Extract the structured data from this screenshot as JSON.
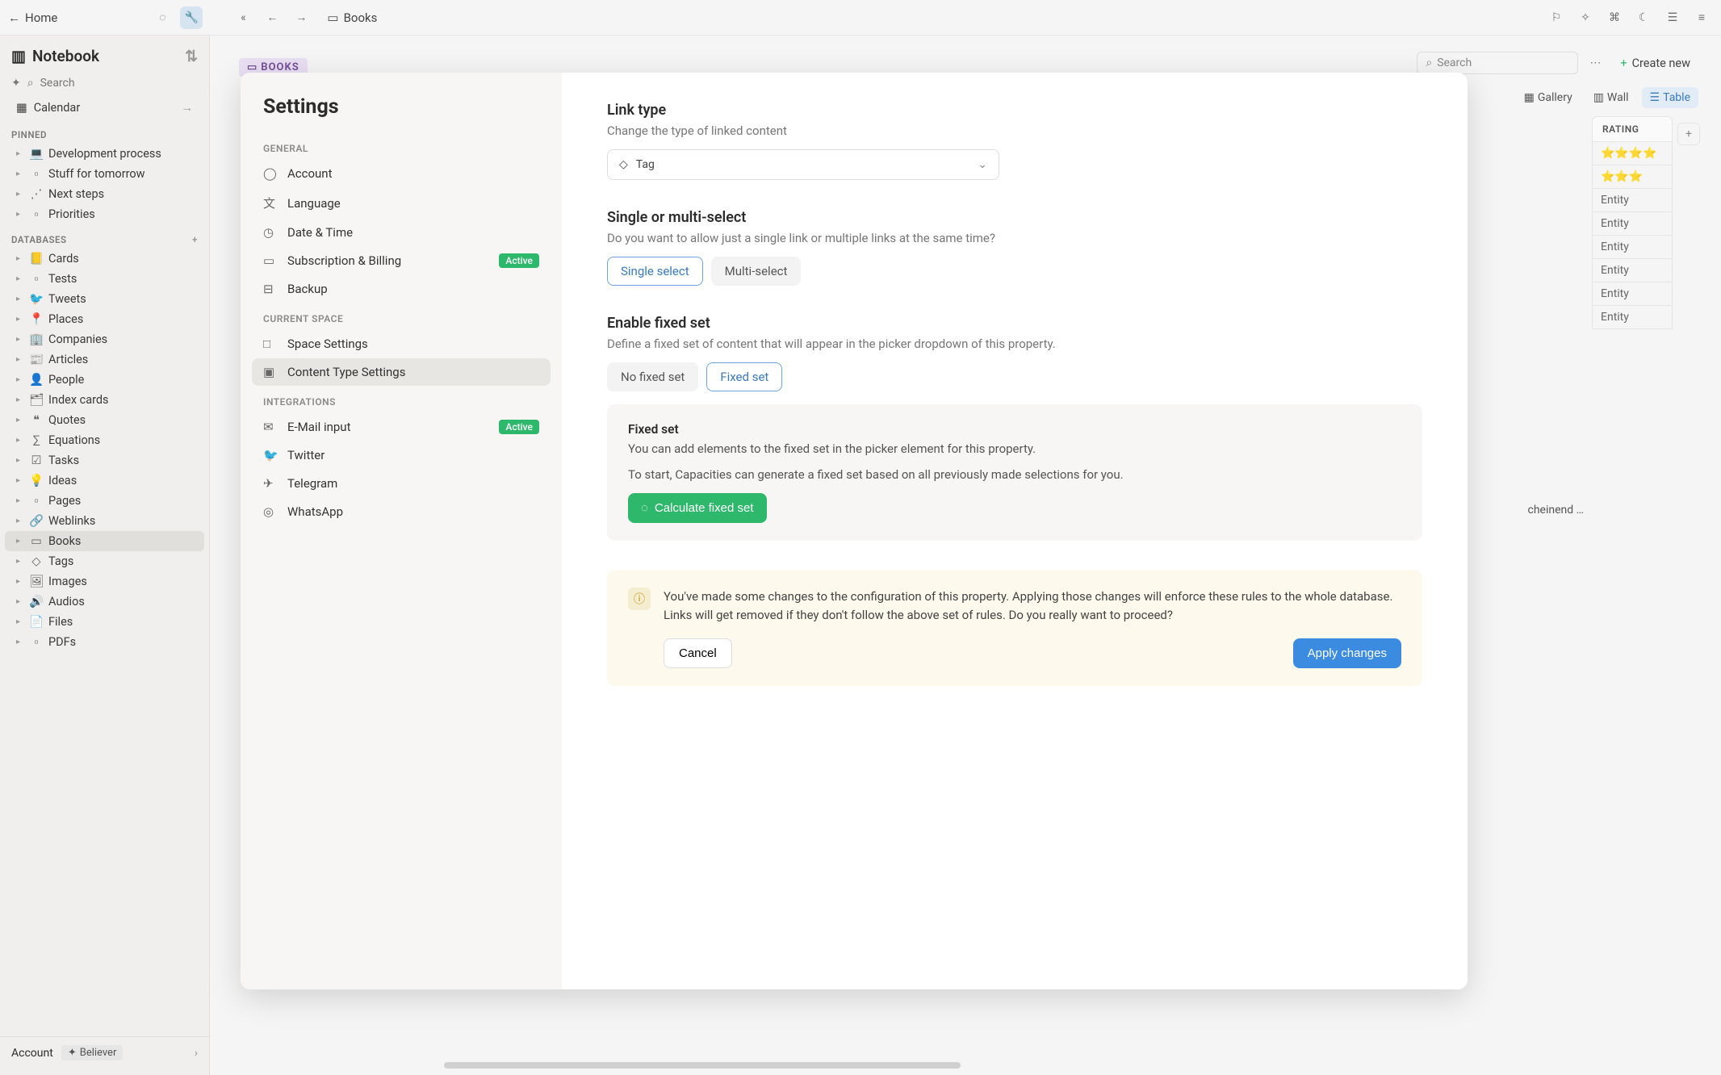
{
  "top": {
    "home": "Home",
    "breadcrumb": "Books"
  },
  "sidebar": {
    "title": "Notebook",
    "search_placeholder": "Search",
    "calendar": "Calendar",
    "pinned_label": "PINNED",
    "pinned": [
      {
        "label": "Development process",
        "icon": "💻"
      },
      {
        "label": "Stuff for tomorrow",
        "icon": "page"
      },
      {
        "label": "Next steps",
        "icon": "steps"
      },
      {
        "label": "Priorities",
        "icon": "page"
      }
    ],
    "databases_label": "DATABASES",
    "databases": [
      {
        "label": "Cards",
        "icon": "📒"
      },
      {
        "label": "Tests",
        "icon": "page"
      },
      {
        "label": "Tweets",
        "icon": "bird"
      },
      {
        "label": "Places",
        "icon": "pin"
      },
      {
        "label": "Companies",
        "icon": "building"
      },
      {
        "label": "Articles",
        "icon": "article"
      },
      {
        "label": "People",
        "icon": "person"
      },
      {
        "label": "Index cards",
        "icon": "card"
      },
      {
        "label": "Quotes",
        "icon": "quote"
      },
      {
        "label": "Equations",
        "icon": "eq"
      },
      {
        "label": "Tasks",
        "icon": "check"
      },
      {
        "label": "Ideas",
        "icon": "bulb"
      },
      {
        "label": "Pages",
        "icon": "page"
      },
      {
        "label": "Weblinks",
        "icon": "link"
      },
      {
        "label": "Books",
        "icon": "book",
        "active": true
      },
      {
        "label": "Tags",
        "icon": "tag"
      },
      {
        "label": "Images",
        "icon": "image"
      },
      {
        "label": "Audios",
        "icon": "audio"
      },
      {
        "label": "Files",
        "icon": "file"
      },
      {
        "label": "PDFs",
        "icon": "pdf"
      }
    ],
    "footer": {
      "account": "Account",
      "badge": "Believer"
    }
  },
  "content": {
    "tag": "BOOKS",
    "search": "Search",
    "create": "Create new",
    "views": {
      "gallery": "Gallery",
      "wall": "Wall",
      "table": "Table"
    },
    "table": {
      "col": "RATING",
      "rows": [
        "⭐⭐⭐⭐",
        "⭐⭐⭐",
        "Entity",
        "Entity",
        "Entity",
        "Entity",
        "Entity",
        "Entity"
      ]
    },
    "partial": "cheinend …"
  },
  "settings": {
    "title": "Settings",
    "sections": {
      "general": "GENERAL",
      "current": "CURRENT SPACE",
      "integrations": "INTEGRATIONS"
    },
    "general_items": [
      {
        "label": "Account",
        "icon": "user"
      },
      {
        "label": "Language",
        "icon": "lang"
      },
      {
        "label": "Date & Time",
        "icon": "clock"
      },
      {
        "label": "Subscription & Billing",
        "icon": "card",
        "badge": "Active"
      },
      {
        "label": "Backup",
        "icon": "backup"
      }
    ],
    "space_items": [
      {
        "label": "Space Settings",
        "icon": "square"
      },
      {
        "label": "Content Type Settings",
        "icon": "square",
        "active": true
      }
    ],
    "integration_items": [
      {
        "label": "E-Mail input",
        "icon": "mail",
        "badge": "Active"
      },
      {
        "label": "Twitter",
        "icon": "bird"
      },
      {
        "label": "Telegram",
        "icon": "plane"
      },
      {
        "label": "WhatsApp",
        "icon": "whatsapp"
      }
    ],
    "body": {
      "link_type": {
        "title": "Link type",
        "desc": "Change the type of linked content",
        "value": "Tag"
      },
      "select": {
        "title": "Single or multi-select",
        "desc": "Do you want to allow just a single link or multiple links at the same time?",
        "opt1": "Single select",
        "opt2": "Multi-select"
      },
      "fixed": {
        "title": "Enable fixed set",
        "desc": "Define a fixed set of content that will appear in the picker dropdown of this property.",
        "opt1": "No fixed set",
        "opt2": "Fixed set"
      },
      "fixed_box": {
        "title": "Fixed set",
        "line1": "You can add elements to the fixed set in the picker element for this property.",
        "line2": "To start, Capacities can generate a fixed set based on all previously made selections for you.",
        "btn": "Calculate fixed set"
      },
      "warn": {
        "text": "You've made some changes to the configuration of this property. Applying those changes will enforce these rules to the whole database. Links will get removed if they don't follow the above set of rules. Do you really want to proceed?",
        "cancel": "Cancel",
        "apply": "Apply changes"
      }
    }
  }
}
